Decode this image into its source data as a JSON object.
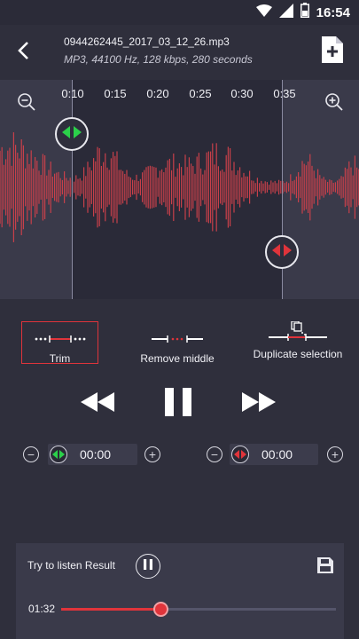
{
  "status": {
    "time": "16:54",
    "icons": [
      "wifi-icon",
      "signal-icon",
      "battery-icon"
    ]
  },
  "header": {
    "file_name": "0944262445_2017_03_12_26.mp3",
    "file_meta": "MP3, 44100 Hz, 128 kbps, 280 seconds",
    "icons": [
      "back-arrow-icon",
      "add-file-icon"
    ]
  },
  "timeline": {
    "ticks": [
      "0:10",
      "0:15",
      "0:20",
      "0:25",
      "0:30",
      "0:35"
    ],
    "icons": [
      "zoom-out-icon",
      "zoom-in-icon"
    ]
  },
  "selection": {
    "start_handle_color": "#2bd04a",
    "end_handle_color": "#e0343b"
  },
  "modes": {
    "trim": "Trim",
    "remove_middle": "Remove middle",
    "duplicate_selection": "Duplicate selection",
    "active": "trim"
  },
  "transport": {
    "icons": [
      "rewind-icon",
      "pause-icon",
      "fast-forward-icon"
    ]
  },
  "start_time": {
    "value": "00:00"
  },
  "end_time": {
    "value": "00:00"
  },
  "result": {
    "title": "Try to listen Result",
    "current_time": "01:32",
    "progress": 0.36,
    "icons": [
      "pause-icon",
      "save-icon"
    ]
  },
  "colors": {
    "accent": "#e0343b",
    "green": "#2bd04a",
    "background": "#2f2f3c",
    "waveform": "#c8404a"
  }
}
